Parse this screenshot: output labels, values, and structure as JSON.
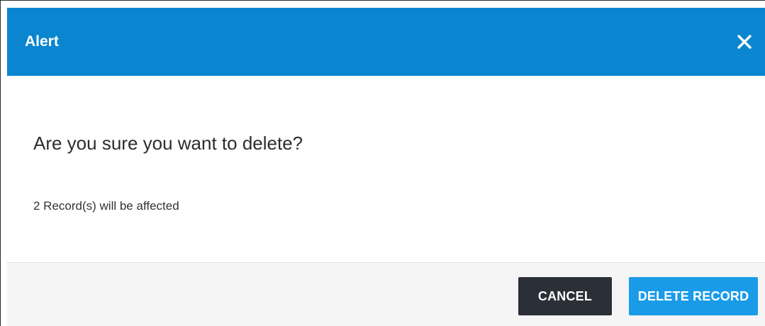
{
  "dialog": {
    "title": "Alert",
    "close_icon": "close-icon",
    "message": "Are you sure you want to delete?",
    "affected_text": "2 Record(s) will be affected",
    "buttons": {
      "cancel_label": "CANCEL",
      "delete_label": "DELETE RECORD"
    }
  },
  "colors": {
    "header_bg": "#0a86d1",
    "cancel_bg": "#2a2f38",
    "delete_bg": "#1a9be8",
    "footer_bg": "#f5f5f5"
  }
}
